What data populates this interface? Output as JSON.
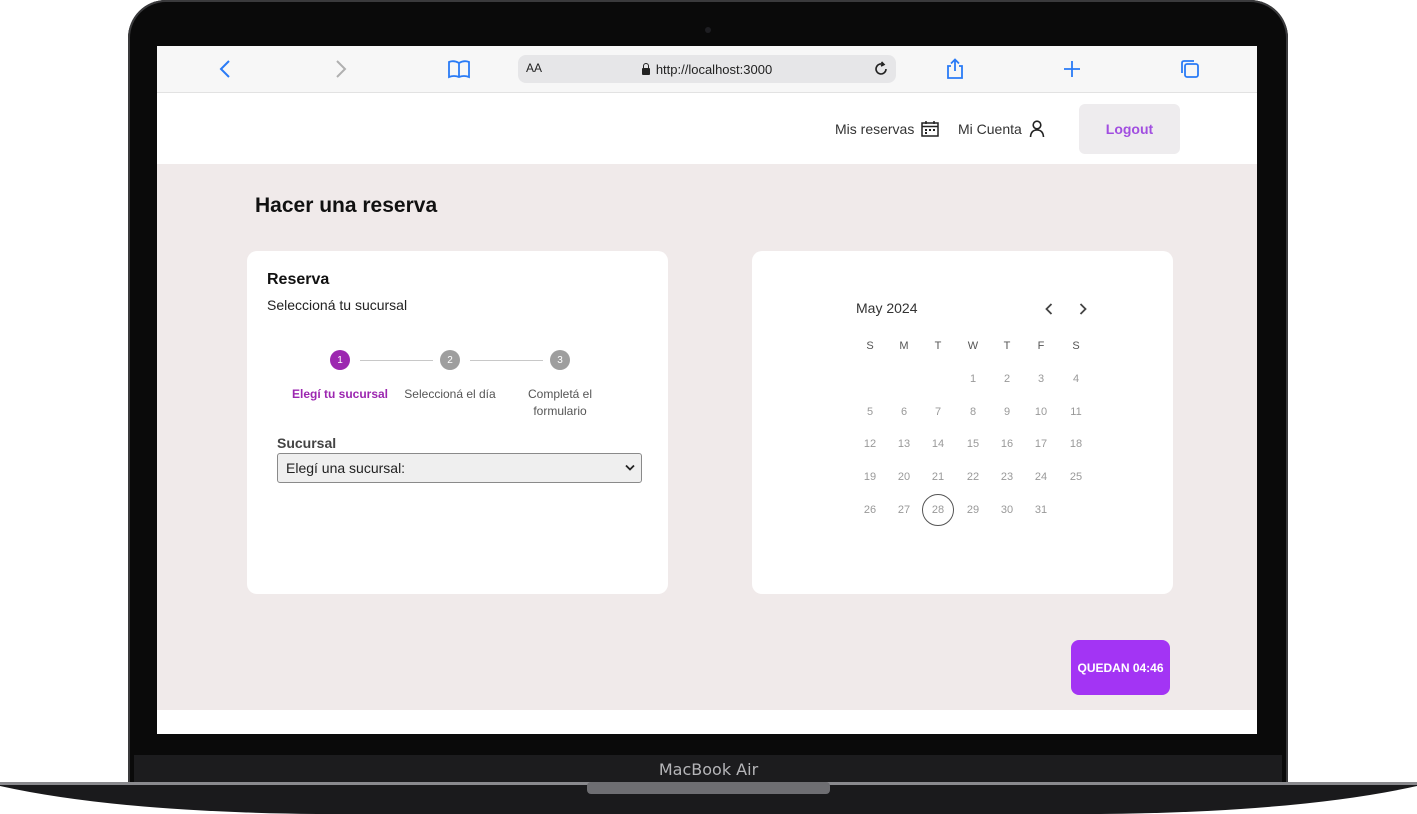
{
  "device": {
    "brand": "MacBook Air"
  },
  "browser": {
    "url": "http://localhost:3000",
    "aa_label": "AA",
    "icons": [
      "back-icon",
      "forward-icon",
      "bookmarks-icon",
      "lock-icon",
      "reload-icon",
      "share-icon",
      "new-tab-icon",
      "tabs-icon"
    ]
  },
  "header": {
    "my_reservations": "Mis reservas",
    "my_account": "Mi Cuenta",
    "logout": "Logout"
  },
  "page": {
    "title": "Hacer una reserva"
  },
  "reservation": {
    "title": "Reserva",
    "subtitle": "Seleccioná tu sucursal",
    "steps": [
      {
        "number": "1",
        "label": "Elegí tu sucursal",
        "active": true
      },
      {
        "number": "2",
        "label": "Seleccioná el día",
        "active": false
      },
      {
        "number": "3",
        "label": "Completá el formulario",
        "active": false
      }
    ],
    "branch_label": "Sucursal",
    "branch_value": "Elegí una sucursal:"
  },
  "calendar": {
    "month": "May 2024",
    "weekdays": [
      "S",
      "M",
      "T",
      "W",
      "T",
      "F",
      "S"
    ],
    "weeks": [
      [
        "",
        "",
        "",
        "1",
        "2",
        "3",
        "4"
      ],
      [
        "5",
        "6",
        "7",
        "8",
        "9",
        "10",
        "11"
      ],
      [
        "12",
        "13",
        "14",
        "15",
        "16",
        "17",
        "18"
      ],
      [
        "19",
        "20",
        "21",
        "22",
        "23",
        "24",
        "25"
      ],
      [
        "26",
        "27",
        "28",
        "29",
        "30",
        "31",
        ""
      ]
    ],
    "today": "28"
  },
  "timer": {
    "label": "QUEDAN 04:46"
  },
  "colors": {
    "accent": "#a334f4",
    "step_active": "#9c27b0",
    "step_inactive": "#9e9e9e",
    "logout_text": "#a14ee0",
    "page_background": "#f0eaea"
  }
}
